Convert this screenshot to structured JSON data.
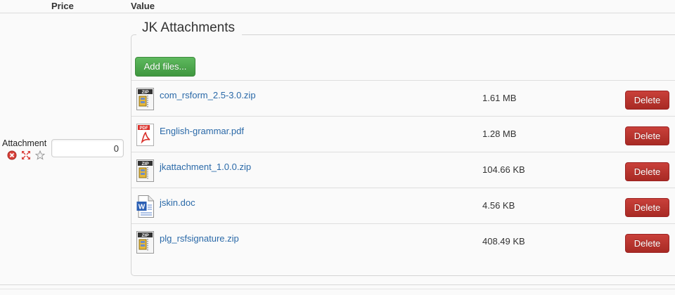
{
  "columns": {
    "price": "Price",
    "value": "Value"
  },
  "attachment": {
    "label": "Attachment",
    "price_value": "0",
    "icons": [
      "remove-icon",
      "expand-icon",
      "star-icon"
    ]
  },
  "fieldset": {
    "legend": "JK Attachments",
    "add_button": "Add files..."
  },
  "files": [
    {
      "name": "com_rsform_2.5-3.0.zip",
      "size": "1.61 MB",
      "type": "zip",
      "delete": "Delete"
    },
    {
      "name": "English-grammar.pdf",
      "size": "1.28 MB",
      "type": "pdf",
      "delete": "Delete"
    },
    {
      "name": "jkattachment_1.0.0.zip",
      "size": "104.66 KB",
      "type": "zip",
      "delete": "Delete"
    },
    {
      "name": "jskin.doc",
      "size": "4.56 KB",
      "type": "doc",
      "delete": "Delete"
    },
    {
      "name": "plg_rsfsignature.zip",
      "size": "408.49 KB",
      "type": "zip",
      "delete": "Delete"
    }
  ],
  "colors": {
    "add": "#4cae4c",
    "delete": "#b5322c",
    "link": "#2a69a8"
  }
}
